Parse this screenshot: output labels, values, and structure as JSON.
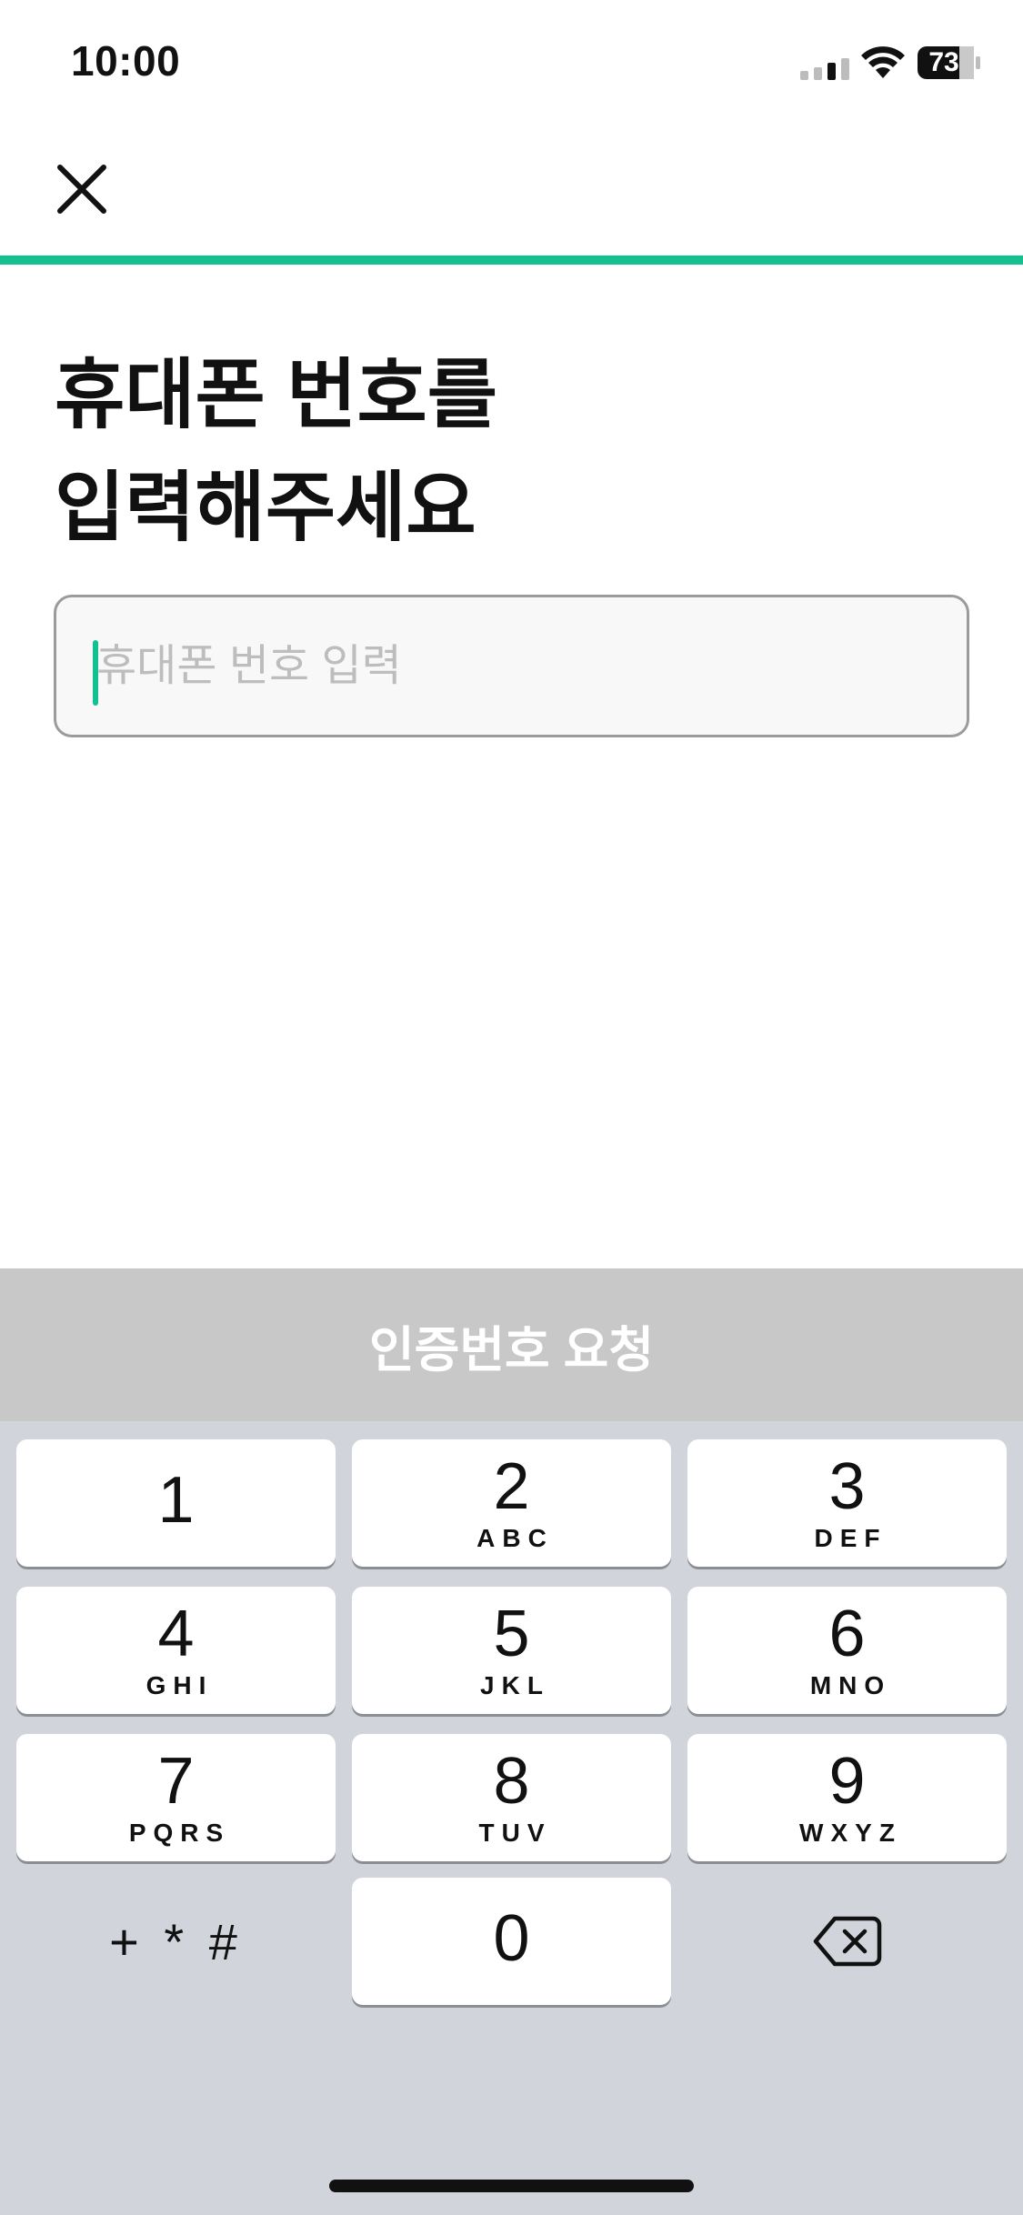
{
  "status_bar": {
    "time": "10:00",
    "battery_level": "73",
    "icons": [
      "cellular-signal-icon",
      "wifi-icon",
      "battery-icon"
    ]
  },
  "header": {
    "close_icon": "close-icon",
    "progress_fraction": 1.0,
    "progress_color": "#12c18f"
  },
  "title": {
    "line1": "휴대폰 번호를",
    "line2": "입력해주세요"
  },
  "phone_input": {
    "placeholder": "휴대폰 번호 입력",
    "value": ""
  },
  "request_button": {
    "label": "인증번호 요청"
  },
  "keypad": {
    "keys": [
      {
        "digit": "1",
        "letters": ""
      },
      {
        "digit": "2",
        "letters": "ABC"
      },
      {
        "digit": "3",
        "letters": "DEF"
      },
      {
        "digit": "4",
        "letters": "GHI"
      },
      {
        "digit": "5",
        "letters": "JKL"
      },
      {
        "digit": "6",
        "letters": "MNO"
      },
      {
        "digit": "7",
        "letters": "PQRS"
      },
      {
        "digit": "8",
        "letters": "TUV"
      },
      {
        "digit": "9",
        "letters": "WXYZ"
      },
      {
        "digit": "0",
        "letters": ""
      }
    ],
    "symbols_label": "+ * #",
    "delete_icon": "backspace-icon"
  }
}
